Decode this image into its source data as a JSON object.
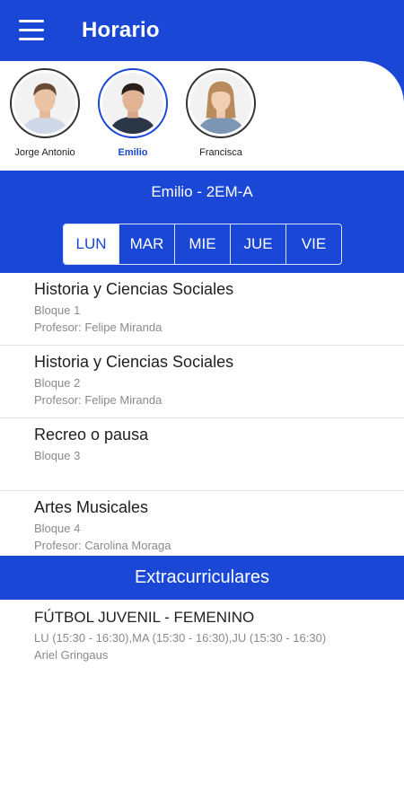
{
  "app_bar": {
    "title": "Horario",
    "menu_icon": "hamburger-icon"
  },
  "students": [
    {
      "name": "Jorge Antonio",
      "selected": false
    },
    {
      "name": "Emilio",
      "selected": true
    },
    {
      "name": "Francisca",
      "selected": false
    }
  ],
  "class_title": "Emilio - 2EM-A",
  "days": [
    "LUN",
    "MAR",
    "MIE",
    "JUE",
    "VIE"
  ],
  "active_day": "LUN",
  "schedule": [
    {
      "subject": "Historia y Ciencias Sociales",
      "block": "Bloque 1",
      "teacher": "Profesor: Felipe Miranda"
    },
    {
      "subject": "Historia y Ciencias Sociales",
      "block": "Bloque 2",
      "teacher": "Profesor: Felipe Miranda"
    },
    {
      "subject": "Recreo o pausa",
      "block": "Bloque 3",
      "teacher": ""
    },
    {
      "subject": "Artes Musicales",
      "block": "Bloque 4",
      "teacher": "Profesor: Carolina Moraga"
    }
  ],
  "extracurricular": {
    "header": "Extracurriculares",
    "items": [
      {
        "title": "FÚTBOL JUVENIL - FEMENINO",
        "schedule": "LU (15:30 - 16:30),MA (15:30 - 16:30),JU (15:30 - 16:30)",
        "instructor": "Ariel Gringaus"
      }
    ]
  },
  "colors": {
    "primary": "#1a47d6",
    "text": "#202020",
    "muted": "#8a8a8a"
  }
}
